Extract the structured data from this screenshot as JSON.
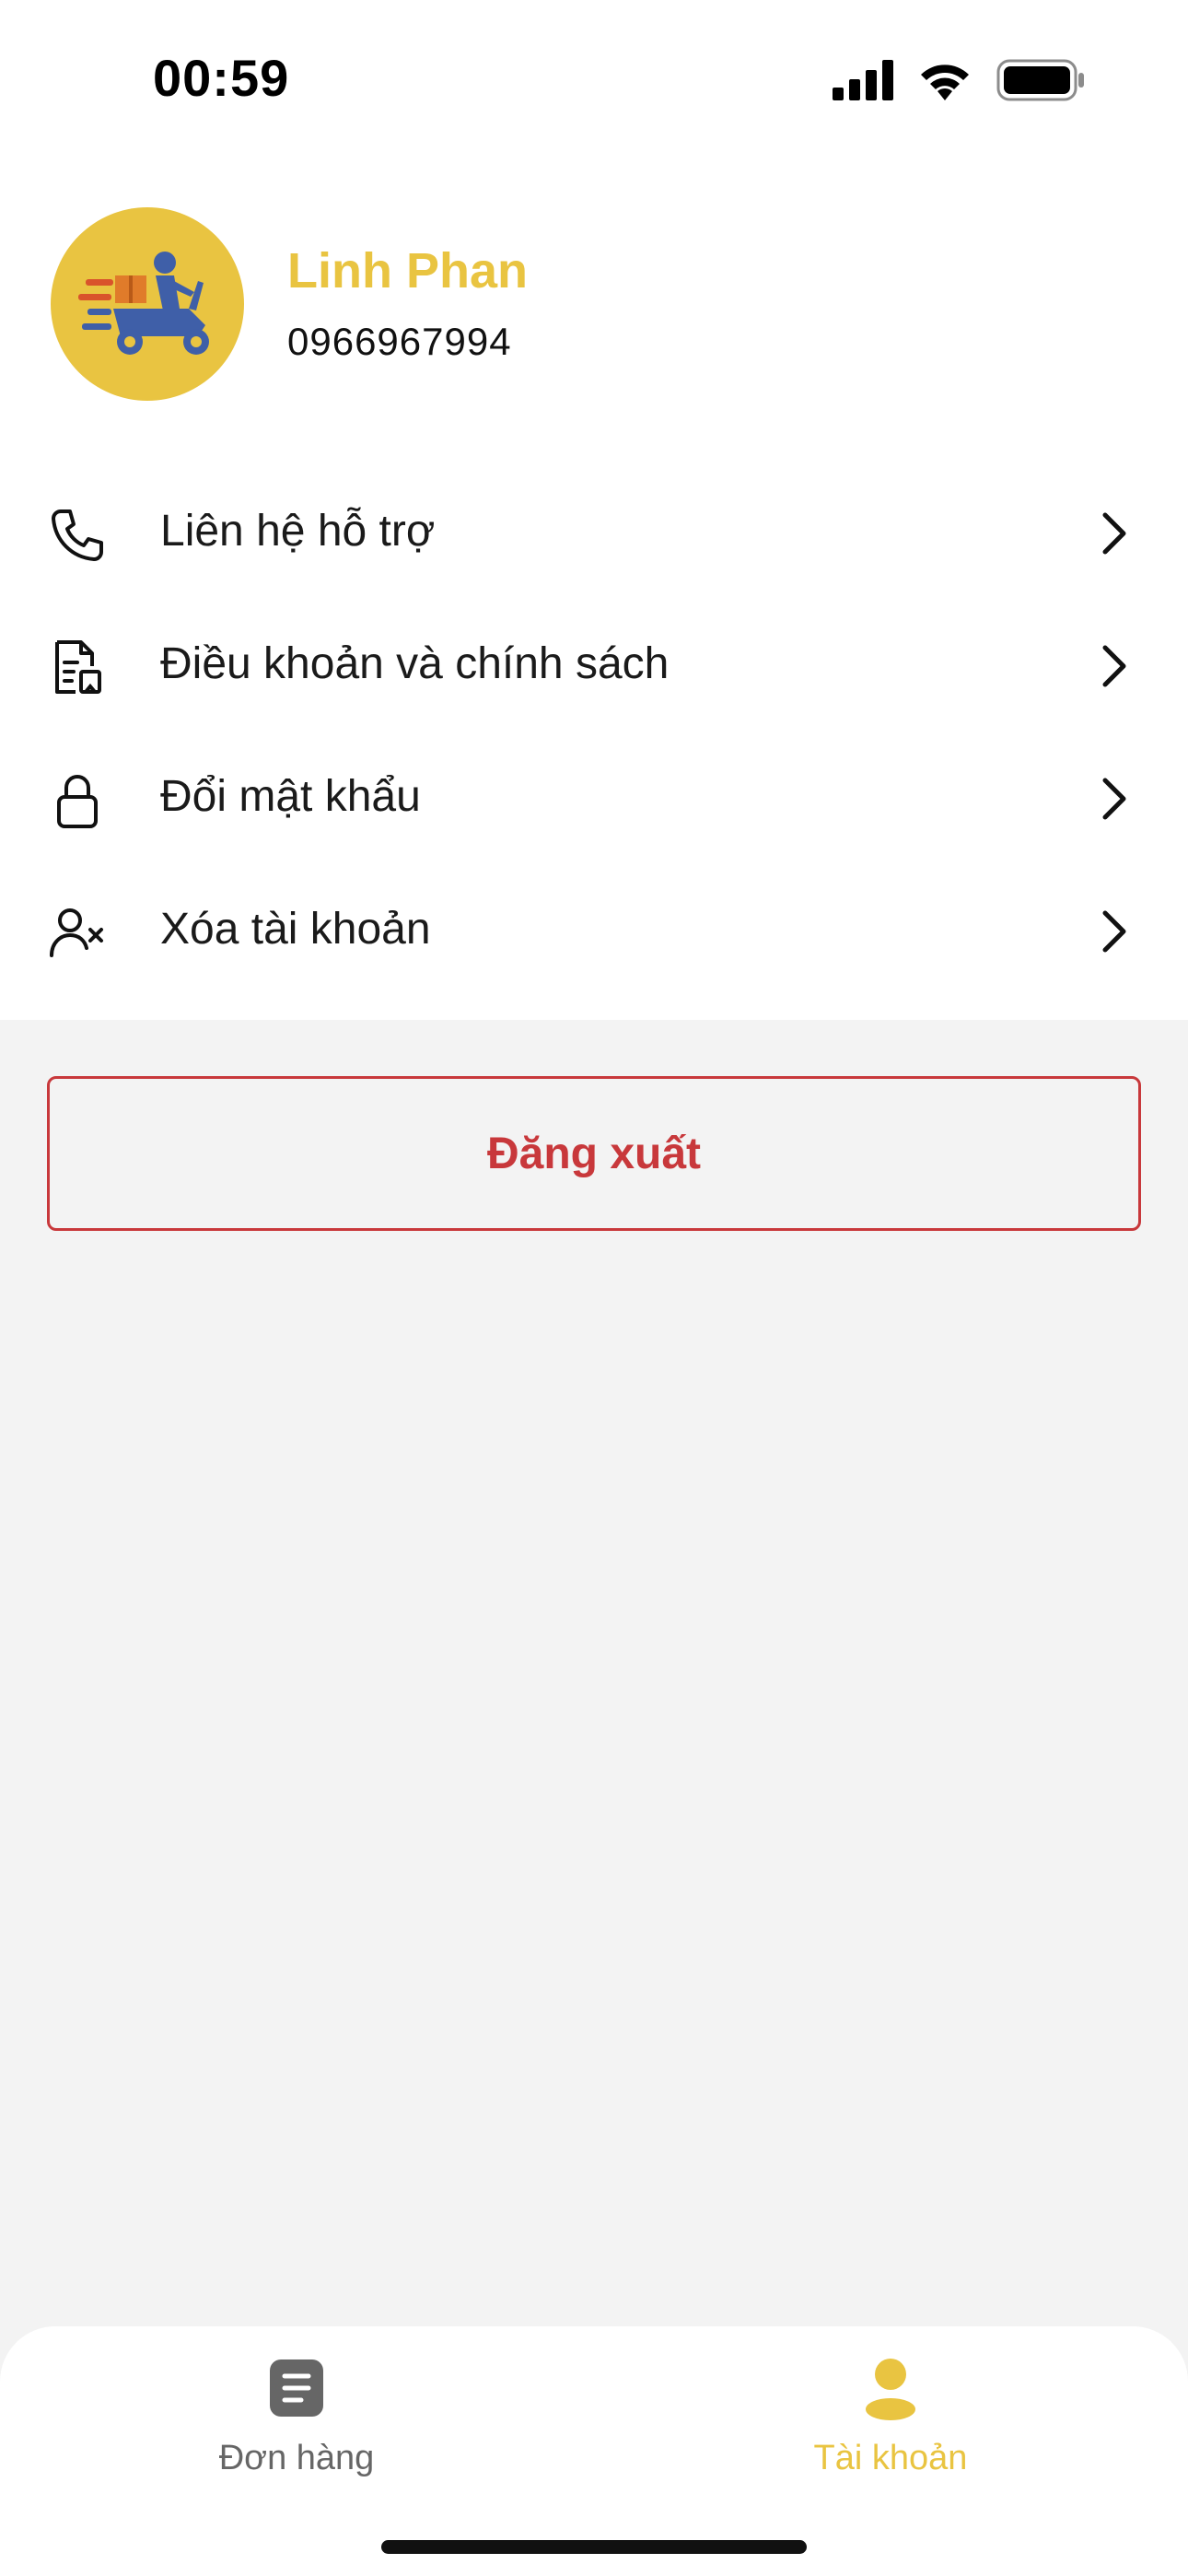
{
  "status_bar": {
    "time": "00:59"
  },
  "profile": {
    "name": "Linh Phan",
    "phone": "0966967994"
  },
  "menu": {
    "items": [
      {
        "label": "Liên hệ hỗ trợ",
        "icon": "phone-icon"
      },
      {
        "label": "Điều khoản và chính sách",
        "icon": "document-icon"
      },
      {
        "label": "Đổi mật khẩu",
        "icon": "lock-icon"
      },
      {
        "label": "Xóa tài khoản",
        "icon": "user-remove-icon"
      }
    ]
  },
  "logout": {
    "label": "Đăng xuất"
  },
  "tabs": [
    {
      "label": "Đơn hàng",
      "icon": "orders-icon",
      "active": false
    },
    {
      "label": "Tài khoản",
      "icon": "user-icon",
      "active": true
    }
  ],
  "colors": {
    "accent": "#e9c441",
    "danger": "#c8383b",
    "background": "#f3f3f3",
    "inactive_tab": "#666666"
  }
}
